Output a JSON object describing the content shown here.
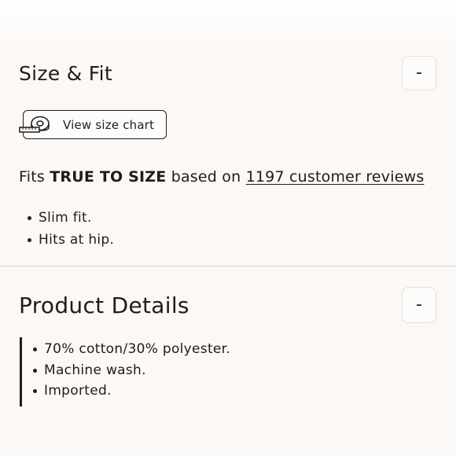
{
  "size_fit": {
    "title": "Size & Fit",
    "toggle_label": "-",
    "size_chart_label": "View size chart",
    "fit_prefix": "Fits ",
    "fit_value": "TRUE TO SIZE",
    "fit_middle": " based on ",
    "reviews_link": "1197 customer reviews",
    "bullets": [
      "Slim fit.",
      "Hits at hip."
    ]
  },
  "product_details": {
    "title": "Product Details",
    "toggle_label": "-",
    "bullets": [
      "70% cotton/30% polyester.",
      "Machine wash.",
      "Imported."
    ]
  }
}
